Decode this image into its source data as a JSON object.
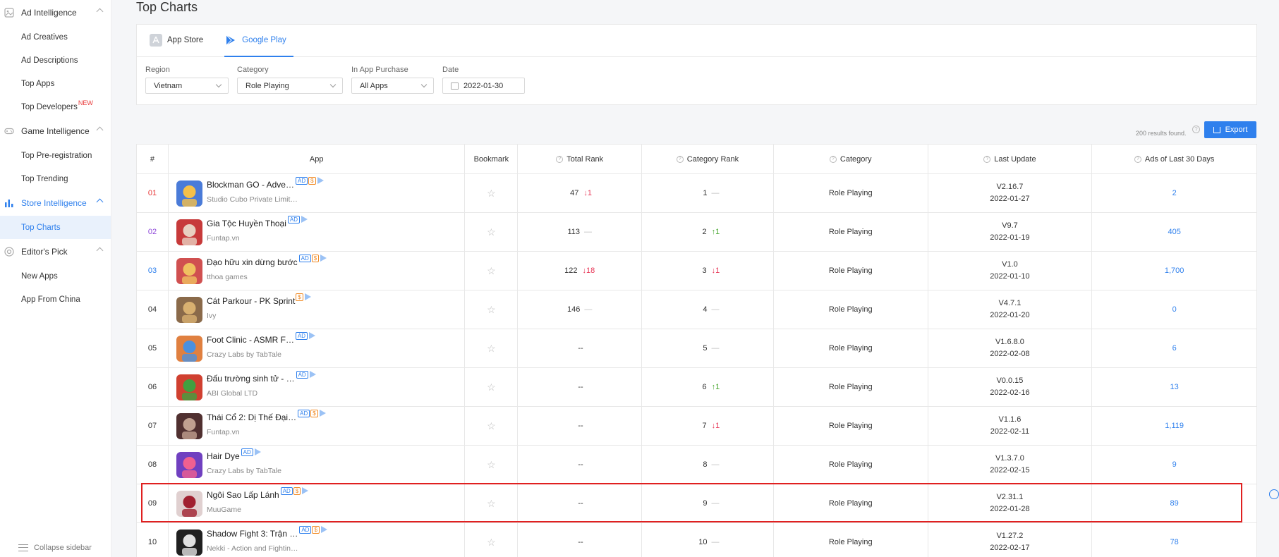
{
  "sidebar": {
    "groups": [
      {
        "label": "Ad Intelligence",
        "items": [
          "Ad Creatives",
          "Ad Descriptions",
          "Top Apps",
          "Top Developers"
        ]
      },
      {
        "label": "Game Intelligence",
        "items": [
          "Top Pre-registration",
          "Top Trending"
        ]
      },
      {
        "label": "Store Intelligence",
        "items": [
          "Top Charts"
        ]
      },
      {
        "label": "Editor's Pick",
        "items": [
          "New Apps",
          "App From China"
        ]
      }
    ],
    "new_badge": "NEW",
    "collapse_label": "Collapse sidebar"
  },
  "page": {
    "title": "Top Charts"
  },
  "tabs": [
    {
      "label": "App Store"
    },
    {
      "label": "Google Play"
    }
  ],
  "filters": {
    "region": {
      "label": "Region",
      "value": "Vietnam"
    },
    "category": {
      "label": "Category",
      "value": "Role Playing"
    },
    "iap": {
      "label": "In App Purchase",
      "value": "All Apps"
    },
    "date": {
      "label": "Date",
      "value": "2022-01-30"
    }
  },
  "results_text": "200 results found.",
  "export_label": "Export",
  "table": {
    "headers": {
      "idx": "#",
      "app": "App",
      "bookmark": "Bookmark",
      "total_rank": "Total Rank",
      "category_rank": "Category Rank",
      "category": "Category",
      "last_update": "Last Update",
      "ads": "Ads of Last 30 Days"
    },
    "rows": [
      {
        "idx": "01",
        "name": "Blockman GO - Adve…",
        "dev": "Studio Cubo Private Limit…",
        "total_rank": "47",
        "total_change": "↓1",
        "total_dir": "down",
        "cat_rank": "1",
        "cat_change": "—",
        "cat_dir": "none",
        "category": "Role Playing",
        "version": "V2.16.7",
        "date": "2022-01-27",
        "ads": "2",
        "badges": [
          "AD",
          "$",
          "play"
        ]
      },
      {
        "idx": "02",
        "name": "Gia Tộc Huyền Thoại",
        "dev": "Funtap.vn",
        "total_rank": "113",
        "total_change": "—",
        "total_dir": "none",
        "cat_rank": "2",
        "cat_change": "↑1",
        "cat_dir": "up",
        "category": "Role Playing",
        "version": "V9.7",
        "date": "2022-01-19",
        "ads": "405",
        "badges": [
          "AD",
          "play"
        ]
      },
      {
        "idx": "03",
        "name": "Đạo hữu xin dừng bước",
        "dev": "tthoa games",
        "total_rank": "122",
        "total_change": "↓18",
        "total_dir": "down",
        "cat_rank": "3",
        "cat_change": "↓1",
        "cat_dir": "down",
        "category": "Role Playing",
        "version": "V1.0",
        "date": "2022-01-10",
        "ads": "1,700",
        "badges": [
          "AD",
          "$",
          "play"
        ]
      },
      {
        "idx": "04",
        "name": "Cát Parkour - PK Sprint",
        "dev": "Ivy",
        "total_rank": "146",
        "total_change": "—",
        "total_dir": "none",
        "cat_rank": "4",
        "cat_change": "—",
        "cat_dir": "none",
        "category": "Role Playing",
        "version": "V4.7.1",
        "date": "2022-01-20",
        "ads": "0",
        "badges": [
          "$",
          "play"
        ]
      },
      {
        "idx": "05",
        "name": "Foot Clinic - ASMR F…",
        "dev": "Crazy Labs by TabTale",
        "total_rank": "--",
        "total_change": "",
        "total_dir": "none",
        "cat_rank": "5",
        "cat_change": "—",
        "cat_dir": "none",
        "category": "Role Playing",
        "version": "V1.6.8.0",
        "date": "2022-02-08",
        "ads": "6",
        "badges": [
          "AD",
          "play"
        ]
      },
      {
        "idx": "06",
        "name": "Đấu trường sinh tử - …",
        "dev": "ABI Global LTD",
        "total_rank": "--",
        "total_change": "",
        "total_dir": "none",
        "cat_rank": "6",
        "cat_change": "↑1",
        "cat_dir": "up",
        "category": "Role Playing",
        "version": "V0.0.15",
        "date": "2022-02-16",
        "ads": "13",
        "badges": [
          "AD",
          "play"
        ]
      },
      {
        "idx": "07",
        "name": "Thái Cổ 2: Dị Thế Đại…",
        "dev": "Funtap.vn",
        "total_rank": "--",
        "total_change": "",
        "total_dir": "none",
        "cat_rank": "7",
        "cat_change": "↓1",
        "cat_dir": "down",
        "category": "Role Playing",
        "version": "V1.1.6",
        "date": "2022-02-11",
        "ads": "1,119",
        "badges": [
          "AD",
          "$",
          "play"
        ]
      },
      {
        "idx": "08",
        "name": "Hair Dye",
        "dev": "Crazy Labs by TabTale",
        "total_rank": "--",
        "total_change": "",
        "total_dir": "none",
        "cat_rank": "8",
        "cat_change": "—",
        "cat_dir": "none",
        "category": "Role Playing",
        "version": "V1.3.7.0",
        "date": "2022-02-15",
        "ads": "9",
        "badges": [
          "AD",
          "play"
        ]
      },
      {
        "idx": "09",
        "name": "Ngôi Sao Lấp Lánh",
        "dev": "MuuGame",
        "total_rank": "--",
        "total_change": "",
        "total_dir": "none",
        "cat_rank": "9",
        "cat_change": "—",
        "cat_dir": "none",
        "category": "Role Playing",
        "version": "V2.31.1",
        "date": "2022-01-28",
        "ads": "89",
        "badges": [
          "AD",
          "$",
          "play"
        ]
      },
      {
        "idx": "10",
        "name": "Shadow Fight 3: Trận …",
        "dev": "Nekki - Action and Fightin…",
        "total_rank": "--",
        "total_change": "",
        "total_dir": "none",
        "cat_rank": "10",
        "cat_change": "—",
        "cat_dir": "none",
        "category": "Role Playing",
        "version": "V1.27.2",
        "date": "2022-02-17",
        "ads": "78",
        "badges": [
          "AD",
          "$",
          "play"
        ]
      }
    ]
  },
  "colors": {
    "accent": "#2f80ed",
    "highlight": "#e02020",
    "down": "#e83a5a",
    "up": "#4aa832"
  }
}
